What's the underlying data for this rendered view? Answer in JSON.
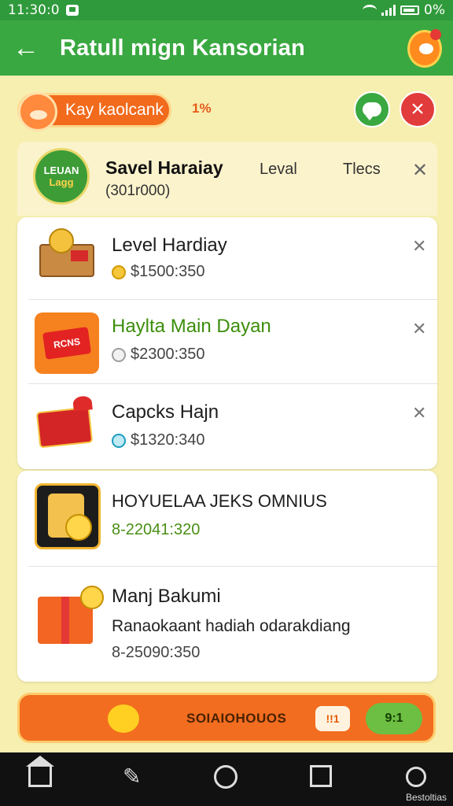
{
  "status_bar": {
    "time": "11:30:0",
    "battery": "0%"
  },
  "app_bar": {
    "title": "Ratull mign Kansorian"
  },
  "top_row": {
    "tag_label": "Kay kaolcank",
    "tag_count": "1%"
  },
  "header": {
    "brand_line1": "LEUAN",
    "brand_line2": "Lagg",
    "title": "Savel Haraiay",
    "subtitle": "(301r000)",
    "col1": "Leval",
    "col2": "Tlecs"
  },
  "items": [
    {
      "name": "Level Hardiay",
      "price": "$1500:350"
    },
    {
      "name": "Haylta Main Dayan",
      "price": "$2300:350",
      "tile_text": "RCNS"
    },
    {
      "name": "Capcks Hajn",
      "price": "$1320:340"
    }
  ],
  "featured": [
    {
      "name": "HOYUELAA JEKS OMNIUS",
      "price": "8-22041:320"
    },
    {
      "name": "Manj Bakumi",
      "description": "Ranaokaant hadiah odarakdiang",
      "price": "8-25090:350"
    }
  ],
  "action_bar": {
    "label": "SOIAIOHOUOS",
    "msg_text": "!!1",
    "button_label": "9:1"
  },
  "nav_bar": {
    "label": "Bestoltias"
  },
  "colors": {
    "primary_green": "#3aa841",
    "accent_orange": "#f26d1f",
    "danger_red": "#e23b3b",
    "background": "#f7efb0"
  }
}
